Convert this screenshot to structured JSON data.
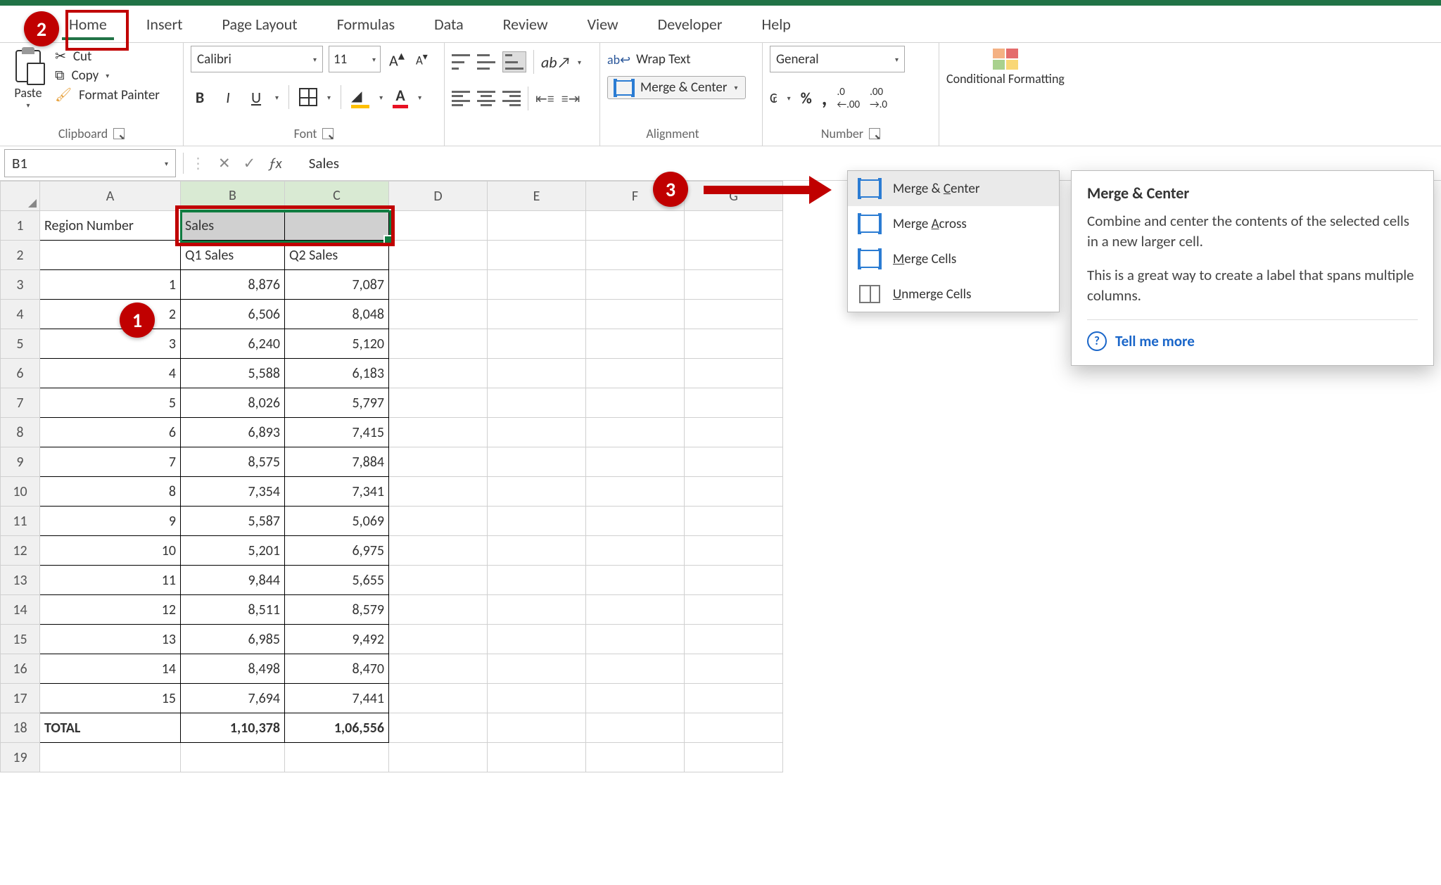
{
  "tabs": [
    "Home",
    "Insert",
    "Page Layout",
    "Formulas",
    "Data",
    "Review",
    "View",
    "Developer",
    "Help"
  ],
  "active_tab": "Home",
  "clipboard": {
    "paste": "Paste",
    "cut": "Cut",
    "copy": "Copy",
    "format_painter": "Format Painter",
    "group_label": "Clipboard"
  },
  "font": {
    "name": "Calibri",
    "size": "11",
    "bold": "B",
    "italic": "I",
    "underline": "U",
    "group_label": "Font"
  },
  "alignment": {
    "wrap_text": "Wrap Text",
    "merge_center": "Merge & Center",
    "group_label": "Alignment"
  },
  "number": {
    "format": "General",
    "percent": "%",
    "comma": ",",
    "inc_dec_left": ".0←",
    "inc_dec_right": "→.0",
    "group_label": "Number"
  },
  "styles": {
    "conditional_formatting": "Conditional Formatting"
  },
  "merge_menu": {
    "merge_center": "Merge & Center",
    "merge_across": "Merge Across",
    "merge_cells": "Merge Cells",
    "unmerge_cells": "Unmerge Cells"
  },
  "tooltip": {
    "title": "Merge & Center",
    "p1": "Combine and center the contents of the selected cells in a new larger cell.",
    "p2": "This is a great way to create a label that spans multiple columns.",
    "tell_me_more": "Tell me more"
  },
  "name_box": "B1",
  "formula_value": "Sales",
  "columns": [
    "A",
    "B",
    "C",
    "D",
    "E",
    "F",
    "G"
  ],
  "headers": {
    "A1": "Region Number",
    "B1": "Sales",
    "B2": "Q1 Sales",
    "C2": "Q2 Sales"
  },
  "rows": [
    {
      "n": "1",
      "b": "8,876",
      "c": "7,087"
    },
    {
      "n": "2",
      "b": "6,506",
      "c": "8,048"
    },
    {
      "n": "3",
      "b": "6,240",
      "c": "5,120"
    },
    {
      "n": "4",
      "b": "5,588",
      "c": "6,183"
    },
    {
      "n": "5",
      "b": "8,026",
      "c": "5,797"
    },
    {
      "n": "6",
      "b": "6,893",
      "c": "7,415"
    },
    {
      "n": "7",
      "b": "8,575",
      "c": "7,884"
    },
    {
      "n": "8",
      "b": "7,354",
      "c": "7,341"
    },
    {
      "n": "9",
      "b": "5,587",
      "c": "5,069"
    },
    {
      "n": "10",
      "b": "5,201",
      "c": "6,975"
    },
    {
      "n": "11",
      "b": "9,844",
      "c": "5,655"
    },
    {
      "n": "12",
      "b": "8,511",
      "c": "8,579"
    },
    {
      "n": "13",
      "b": "6,985",
      "c": "9,492"
    },
    {
      "n": "14",
      "b": "8,498",
      "c": "8,470"
    },
    {
      "n": "15",
      "b": "7,694",
      "c": "7,441"
    }
  ],
  "totals": {
    "label": "TOTAL",
    "b": "1,10,378",
    "c": "1,06,556"
  },
  "callouts": {
    "c1": "1",
    "c2": "2",
    "c3": "3"
  }
}
